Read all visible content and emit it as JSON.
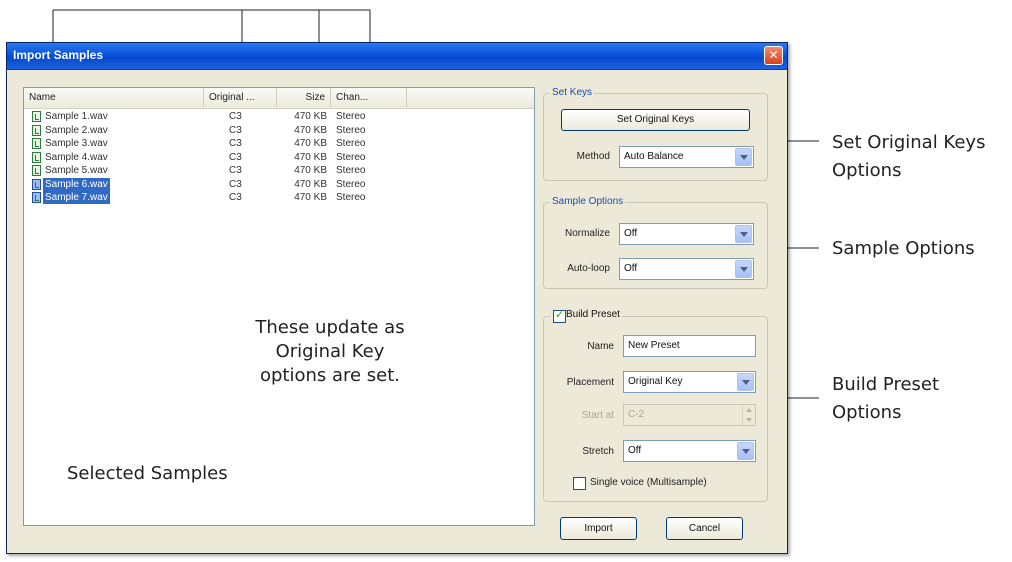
{
  "window": {
    "title": "Import Samples",
    "close_icon": "close-icon"
  },
  "list": {
    "columns": [
      "Name",
      "Original ...",
      "Size",
      "Chan..."
    ],
    "rows": [
      {
        "name": "Sample 1.wav",
        "key": "C3",
        "size": "470 KB",
        "channels": "Stereo",
        "selected": false
      },
      {
        "name": "Sample 2.wav",
        "key": "C3",
        "size": "470 KB",
        "channels": "Stereo",
        "selected": false
      },
      {
        "name": "Sample 3.wav",
        "key": "C3",
        "size": "470 KB",
        "channels": "Stereo",
        "selected": false
      },
      {
        "name": "Sample 4.wav",
        "key": "C3",
        "size": "470 KB",
        "channels": "Stereo",
        "selected": false
      },
      {
        "name": "Sample 5.wav",
        "key": "C3",
        "size": "470 KB",
        "channels": "Stereo",
        "selected": false
      },
      {
        "name": "Sample 6.wav",
        "key": "C3",
        "size": "470 KB",
        "channels": "Stereo",
        "selected": true
      },
      {
        "name": "Sample 7.wav",
        "key": "C3",
        "size": "470 KB",
        "channels": "Stereo",
        "selected": true
      }
    ]
  },
  "set_keys": {
    "label": "Set Keys",
    "button": "Set Original Keys",
    "method_label": "Method",
    "method_value": "Auto Balance"
  },
  "sample_options": {
    "label": "Sample Options",
    "normalize_label": "Normalize",
    "normalize_value": "Off",
    "autoloop_label": "Auto-loop",
    "autoloop_value": "Off"
  },
  "build_preset": {
    "label": "Build Preset",
    "checked": true,
    "name_label": "Name",
    "name_value": "New Preset",
    "placement_label": "Placement",
    "placement_value": "Original Key",
    "start_label": "Start at",
    "start_value": "C-2",
    "stretch_label": "Stretch",
    "stretch_value": "Off",
    "single_voice_label": "Single voice (Multisample)",
    "single_voice_checked": false
  },
  "buttons": {
    "import": "Import",
    "cancel": "Cancel"
  },
  "callouts": {
    "set_original_keys_1": "Set Original Keys",
    "set_original_keys_2": "Options",
    "sample_options": "Sample Options",
    "build_preset_1": "Build Preset",
    "build_preset_2": "Options",
    "update_1": "These update as",
    "update_2": "Original Key",
    "update_3": "options are set.",
    "selected": "Selected Samples"
  }
}
